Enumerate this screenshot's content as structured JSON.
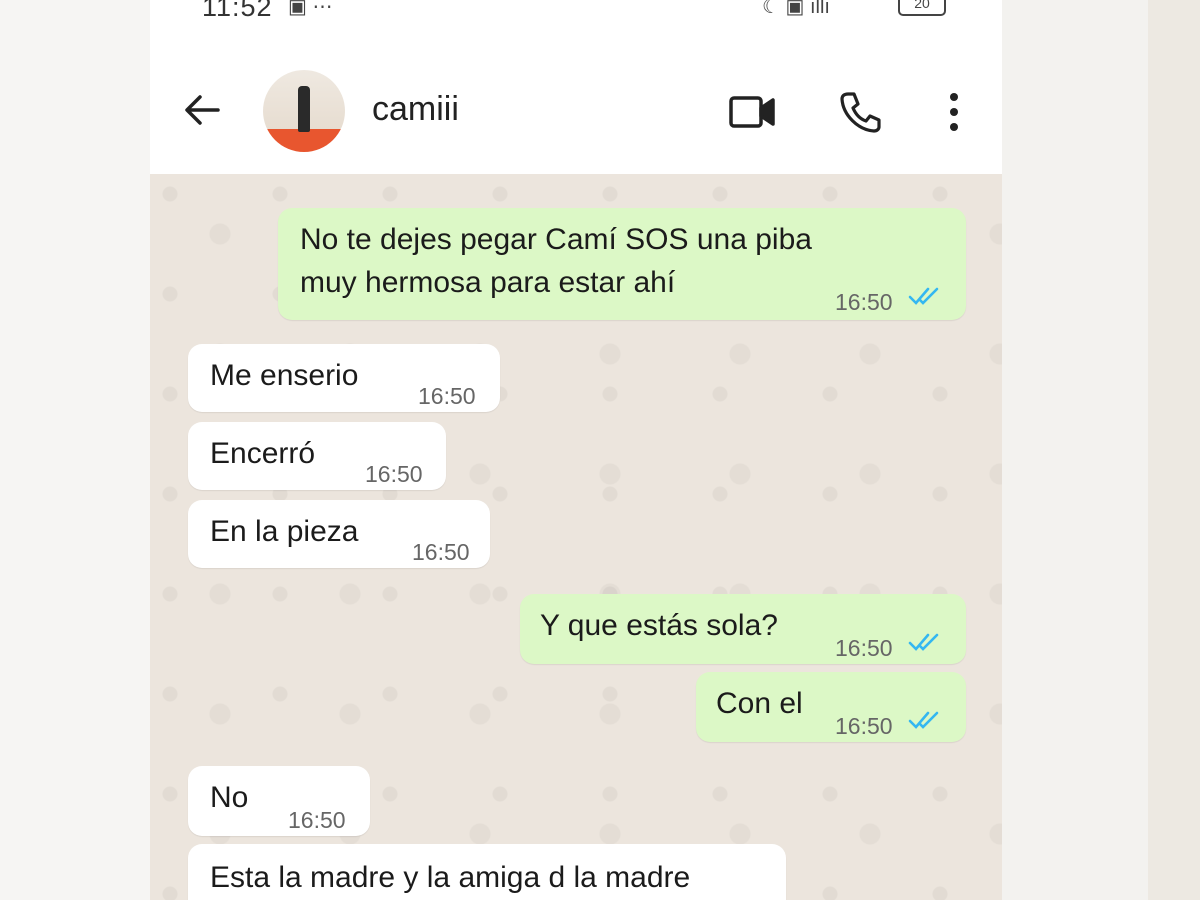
{
  "status_bar": {
    "time": "11:52",
    "battery": "20"
  },
  "header": {
    "contact_name": "camiii"
  },
  "messages": [
    {
      "direction": "outgoing",
      "lines": [
        "No te dejes pegar Camí SOS una piba",
        "muy hermosa para estar ahí"
      ],
      "time": "16:50",
      "read": true
    },
    {
      "direction": "incoming",
      "text": "Me enserio",
      "time": "16:50"
    },
    {
      "direction": "incoming",
      "text": "Encerró",
      "time": "16:50"
    },
    {
      "direction": "incoming",
      "text": "En la pieza",
      "time": "16:50"
    },
    {
      "direction": "outgoing",
      "text": "Y que estás sola?",
      "time": "16:50",
      "read": true
    },
    {
      "direction": "outgoing",
      "text": "Con el",
      "time": "16:50",
      "read": true
    },
    {
      "direction": "incoming",
      "text": "No",
      "time": "16:50"
    },
    {
      "direction": "incoming",
      "text": "Esta la madre y la amiga d la madre",
      "time": ""
    }
  ],
  "colors": {
    "outgoing_bubble": "#dcf8c6",
    "incoming_bubble": "#ffffff",
    "read_ticks": "#34b7f1",
    "chat_background": "#ece5dd"
  },
  "icons": [
    "back-arrow-icon",
    "video-call-icon",
    "phone-call-icon",
    "more-options-icon",
    "double-check-icon"
  ]
}
